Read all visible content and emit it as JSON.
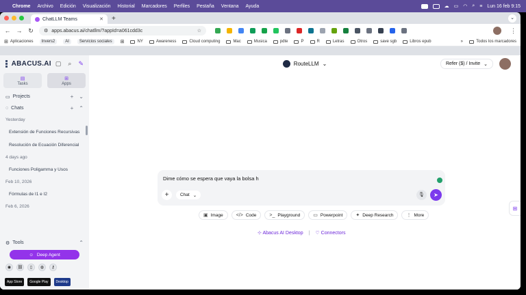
{
  "menubar": {
    "app": "Chrome",
    "items": [
      "Archivo",
      "Edición",
      "Visualización",
      "Historial",
      "Marcadores",
      "Perfiles",
      "Pestaña",
      "Ventana",
      "Ayuda"
    ],
    "clock": "Lun 16 feb 9:15"
  },
  "browser": {
    "tab_title": "ChatLLM Teams",
    "url": "apps.abacus.ai/chatllm/?appId=a061cdd3c",
    "bookmarks": [
      "Aplicaciones",
      "Invers2",
      "AI",
      "Servicios sociales",
      "NY",
      "Awareness",
      "Cloud computing",
      "Mac",
      "Musica",
      "pdte",
      "P",
      "R",
      "Letras",
      "Otros",
      "save sgb",
      "Libros epub"
    ],
    "all_bookmarks": "Todos los marcadores",
    "colors": {
      "menubar": "#5b4b99",
      "accent": "#7c3aed"
    }
  },
  "sidebar": {
    "brand": "ABACUS.AI",
    "tabs": [
      {
        "label": "Tasks",
        "icon": "tasks-icon"
      },
      {
        "label": "Apps",
        "icon": "apps-icon"
      }
    ],
    "projects_label": "Projects",
    "chats_label": "Chats",
    "groups": [
      {
        "label": "Yesterday",
        "chats": [
          "Extensión de Funciones Recursivas",
          "Resolución de Ecuación Diferencial"
        ]
      },
      {
        "label": "4 days ago",
        "chats": [
          "Funciones Poligamma y Usos"
        ]
      },
      {
        "label": "Feb 10, 2026",
        "chats": [
          "Fórmulas de I1 e I2"
        ]
      },
      {
        "label": "Feb 6, 2026",
        "chats": []
      }
    ],
    "tools_label": "Tools",
    "deep_agent": "Deep Agent",
    "stores": [
      "App Store",
      "Google Play",
      "Desktop"
    ]
  },
  "main": {
    "model": "RouteLLM",
    "refer": "Refer ($) / Invite",
    "prompt_text": "Dime cómo se espera que vaya la bolsa h",
    "mode": "Chat",
    "quick_actions": [
      "Image",
      "Code",
      "Playground",
      "Powerpoint",
      "Deep Research",
      "More"
    ],
    "links": [
      "Abacus AI Desktop",
      "Connectors"
    ]
  }
}
